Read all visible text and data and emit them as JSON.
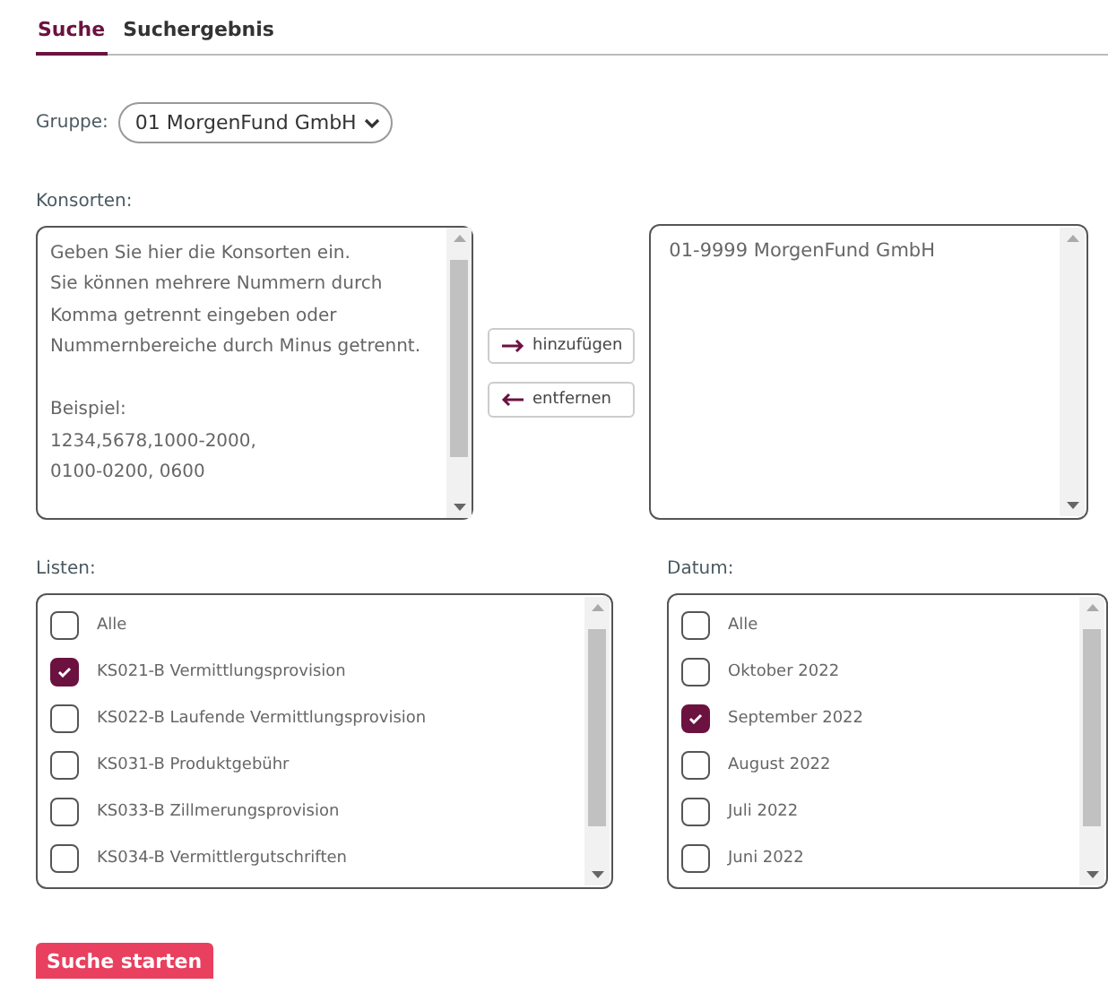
{
  "tabs": [
    {
      "label": "Suche",
      "selected": true
    },
    {
      "label": "Suchergebnis",
      "selected": false
    }
  ],
  "group": {
    "label": "Gruppe:",
    "value": "01 MorgenFund GmbH"
  },
  "konsorten": {
    "label": "Konsorten:",
    "placeholder": "Geben Sie hier die Konsorten ein.\nSie können mehrere Nummern durch Komma getrennt eingeben oder Nummernbereiche durch Minus getrennt.\n\nBeispiel:\n1234,5678,1000-2000,\n0100-0200, 0600",
    "add_button": "hinzufügen",
    "remove_button": "entfernen",
    "selected_items": [
      "01-9999 MorgenFund GmbH"
    ]
  },
  "listen": {
    "label": "Listen:",
    "items": [
      {
        "label": "Alle",
        "checked": false
      },
      {
        "label": "KS021-B Vermittlungsprovision",
        "checked": true
      },
      {
        "label": "KS022-B Laufende Vermittlungsprovision",
        "checked": false
      },
      {
        "label": "KS031-B Produktgebühr",
        "checked": false
      },
      {
        "label": "KS033-B Zillmerungsprovision",
        "checked": false
      },
      {
        "label": "KS034-B Vermittlergutschriften",
        "checked": false
      }
    ]
  },
  "datum": {
    "label": "Datum:",
    "items": [
      {
        "label": "Alle",
        "checked": false
      },
      {
        "label": "Oktober 2022",
        "checked": false
      },
      {
        "label": "September 2022",
        "checked": true
      },
      {
        "label": "August 2022",
        "checked": false
      },
      {
        "label": "Juli 2022",
        "checked": false
      },
      {
        "label": "Juni 2022",
        "checked": false
      }
    ]
  },
  "submit_button": "Suche starten"
}
